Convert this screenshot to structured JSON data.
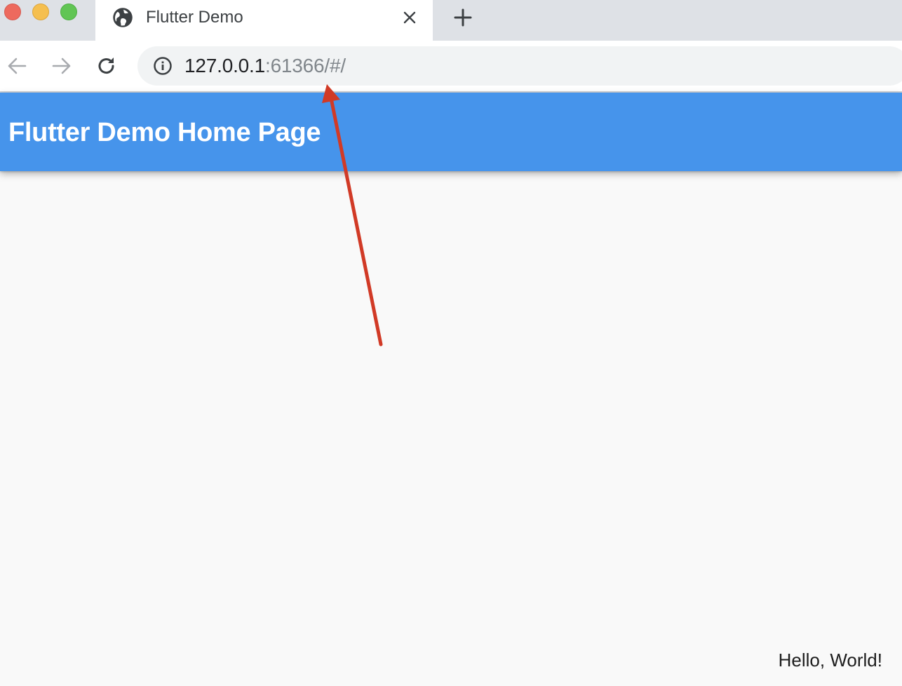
{
  "browser": {
    "tab": {
      "title": "Flutter Demo",
      "favicon": "globe-icon"
    },
    "toolbar": {
      "back_icon": "arrow-left-icon",
      "forward_icon": "arrow-right-icon",
      "reload_icon": "reload-icon",
      "info_icon": "info-icon",
      "url_host": "127.0.0.1",
      "url_rest": ":61366/#/"
    },
    "new_tab_icon": "plus-icon",
    "close_tab_icon": "close-icon"
  },
  "app": {
    "appbar_title": "Flutter Demo Home Page",
    "body_text": "Hello, World!"
  },
  "annotation": {
    "type": "arrow",
    "color": "#d13a26",
    "points_to": "url"
  },
  "colors": {
    "appbar": "#4694eb",
    "tabstrip": "#dee1e6",
    "omnibox": "#f1f3f4",
    "background": "#f9f9f9"
  }
}
